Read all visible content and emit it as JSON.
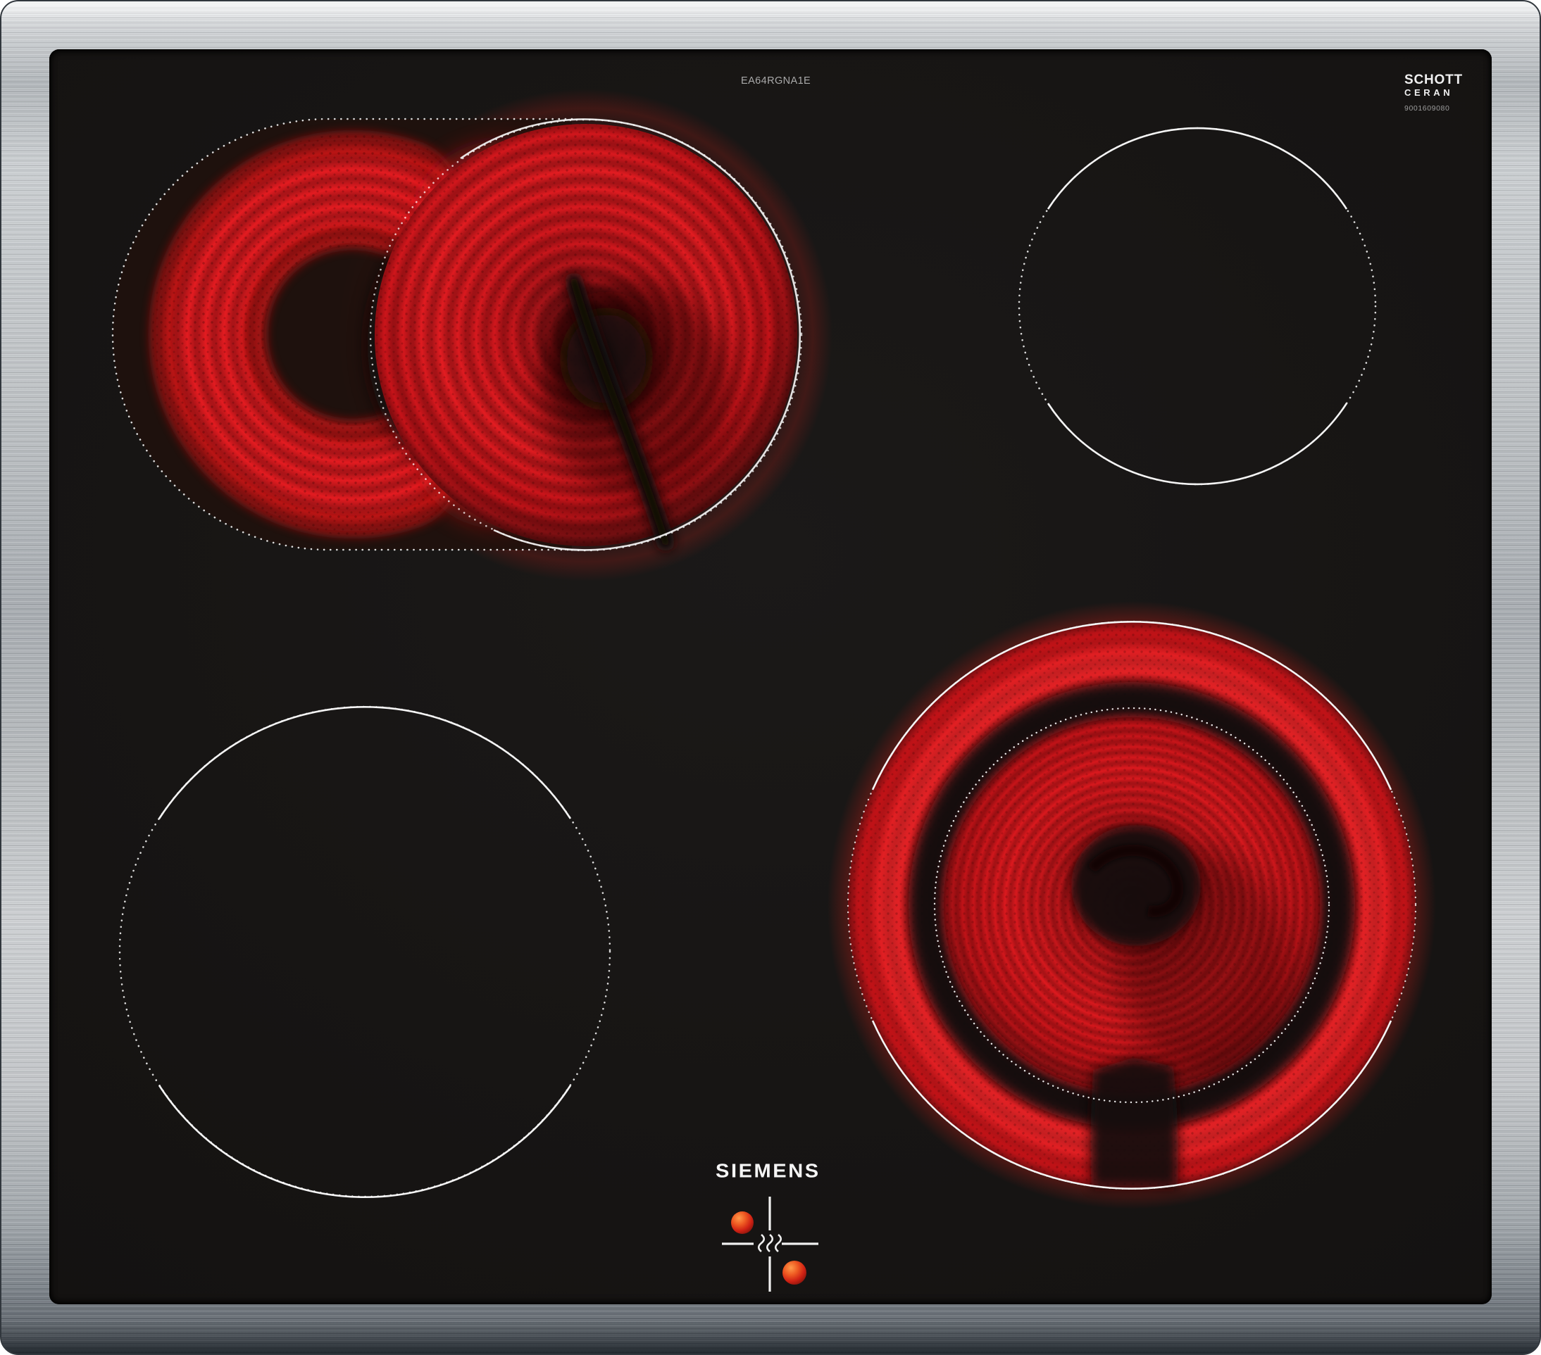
{
  "labels": {
    "model_number": "EA64RGNA1E",
    "brand_logo": "SIEMENS",
    "glass_logo_line1": "SCHOTT",
    "glass_logo_line2": "CERAN",
    "glass_logo_code": "9001609080"
  },
  "zones": [
    {
      "name": "back-left",
      "state": "on",
      "type": "dual-circuit roaster zone with oval extension"
    },
    {
      "name": "back-right",
      "state": "off",
      "type": "single zone"
    },
    {
      "name": "front-left",
      "state": "off",
      "type": "single zone"
    },
    {
      "name": "front-right",
      "state": "on",
      "type": "dual-circuit zone"
    }
  ],
  "indicator": {
    "type": "residual-heat-cross",
    "hot_dots": 2
  },
  "colors": {
    "glow_red": "#e8161d",
    "deep_red": "#8c1013",
    "glass_black": "#141312",
    "steel_light": "#d6d9db",
    "steel_dark": "#434a51",
    "marking_white": "#f2f2f2",
    "hot_dot_orange": "#ee5a22"
  }
}
